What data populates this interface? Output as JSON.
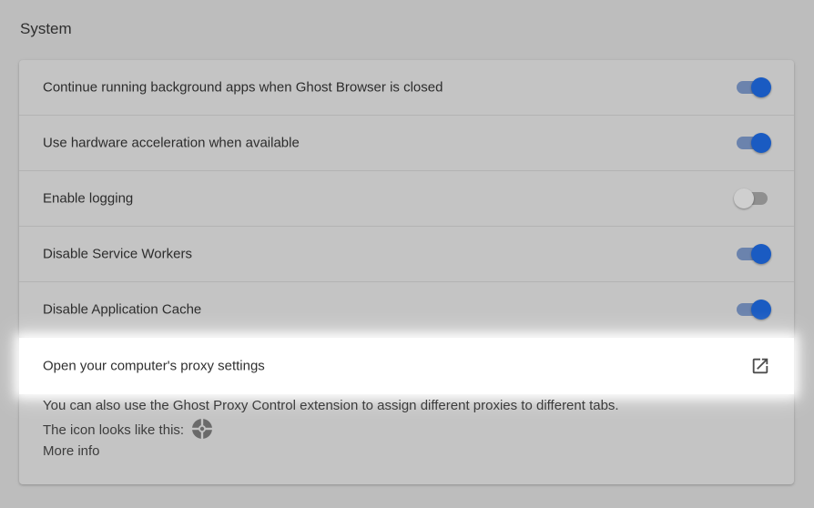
{
  "section": {
    "title": "System"
  },
  "settings": [
    {
      "label": "Continue running background apps when Ghost Browser is closed",
      "enabled": true
    },
    {
      "label": "Use hardware acceleration when available",
      "enabled": true
    },
    {
      "label": "Enable logging",
      "enabled": false
    },
    {
      "label": "Disable Service Workers",
      "enabled": true
    },
    {
      "label": "Disable Application Cache",
      "enabled": true
    }
  ],
  "proxy": {
    "label": "Open your computer's proxy settings",
    "icon": "open-in-new-icon"
  },
  "info": {
    "line1": "You can also use the Ghost Proxy Control extension to assign different proxies to different tabs.",
    "line2": "The icon looks like this:",
    "line2_icon": "proxy-control-icon",
    "more_info": "More info"
  },
  "colors": {
    "toggle_on": "#1a5bc2",
    "toggle_off": "#cfcfcf"
  }
}
